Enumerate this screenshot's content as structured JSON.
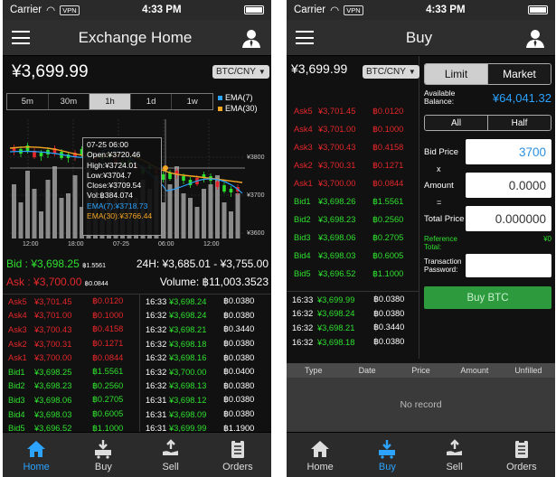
{
  "status": {
    "carrier": "Carrier",
    "vpn": "VPN",
    "time": "4:33 PM"
  },
  "home": {
    "title": "Exchange Home",
    "price": "¥3,699.99",
    "pair": "BTC/CNY",
    "timeframes": [
      "5m",
      "30m",
      "1h",
      "1d",
      "1w"
    ],
    "selected_timeframe": "1h",
    "legend": {
      "ema7": "EMA(7)",
      "ema30": "EMA(30)",
      "ema7_color": "#2ba3ff",
      "ema30_color": "#f5a623"
    },
    "chart": {
      "price_labels": [
        "¥3800",
        "¥3700",
        "¥3600"
      ],
      "time_labels": [
        "12:00",
        "18:00",
        "07-25",
        "06:00",
        "12:00"
      ]
    },
    "tooltip": {
      "date": "07-25 06:00",
      "open_label": "Open:",
      "open": "¥3720.46",
      "high_label": "High:",
      "high": "¥3724.01",
      "low_label": "Low:",
      "low": "¥3704.7",
      "close_label": "Close:",
      "close": "¥3709.54",
      "vol_label": "Vol:",
      "vol": "฿384.074",
      "ema7_label": "EMA(7):",
      "ema7": "¥3718.73",
      "ema30_label": "EMA(30):",
      "ema30": "¥3766.44"
    },
    "summary": {
      "bid_label": "Bid :",
      "bid_price": "¥3,698.25",
      "bid_amount": "฿1.5561",
      "range": "24H: ¥3,685.01 - ¥3,755.00",
      "ask_label": "Ask :",
      "ask_price": "¥3,700.00",
      "ask_amount": "฿0.0844",
      "volume": "Volume: ฿11,003.3523"
    },
    "asks": [
      {
        "label": "Ask5",
        "price": "¥3,701.45",
        "amount": "฿0.0120"
      },
      {
        "label": "Ask4",
        "price": "¥3,701.00",
        "amount": "฿0.1000"
      },
      {
        "label": "Ask3",
        "price": "¥3,700.43",
        "amount": "฿0.4158"
      },
      {
        "label": "Ask2",
        "price": "¥3,700.31",
        "amount": "฿0.1271"
      },
      {
        "label": "Ask1",
        "price": "¥3,700.00",
        "amount": "฿0.0844"
      }
    ],
    "bids": [
      {
        "label": "Bid1",
        "price": "¥3,698.25",
        "amount": "฿1.5561"
      },
      {
        "label": "Bid2",
        "price": "¥3,698.23",
        "amount": "฿0.2560"
      },
      {
        "label": "Bid3",
        "price": "¥3,698.06",
        "amount": "฿0.2705"
      },
      {
        "label": "Bid4",
        "price": "¥3,698.03",
        "amount": "฿0.6005"
      },
      {
        "label": "Bid5",
        "price": "¥3,696.52",
        "amount": "฿1.1000"
      }
    ],
    "trades": [
      {
        "time": "16:33",
        "price": "¥3,698.24",
        "amount": "฿0.0380",
        "side": "buy"
      },
      {
        "time": "16:32",
        "price": "¥3,698.24",
        "amount": "฿0.0380",
        "side": "buy"
      },
      {
        "time": "16:32",
        "price": "¥3,698.21",
        "amount": "฿0.3440",
        "side": "buy"
      },
      {
        "time": "16:32",
        "price": "¥3,698.18",
        "amount": "฿0.0380",
        "side": "buy"
      },
      {
        "time": "16:32",
        "price": "¥3,698.16",
        "amount": "฿0.0380",
        "side": "buy"
      },
      {
        "time": "16:32",
        "price": "¥3,700.00",
        "amount": "฿0.0400",
        "side": "buy"
      },
      {
        "time": "16:32",
        "price": "¥3,698.13",
        "amount": "฿0.0380",
        "side": "buy"
      },
      {
        "time": "16:31",
        "price": "¥3,698.12",
        "amount": "฿0.0380",
        "side": "buy"
      },
      {
        "time": "16:31",
        "price": "¥3,698.09",
        "amount": "฿0.0380",
        "side": "buy"
      },
      {
        "time": "16:31",
        "price": "¥3,699.99",
        "amount": "฿1.1900",
        "side": "buy"
      }
    ]
  },
  "buy": {
    "title": "Buy",
    "price": "¥3,699.99",
    "pair": "BTC/CNY",
    "asks": [
      {
        "label": "Ask5",
        "price": "¥3,701.45",
        "amount": "฿0.0120"
      },
      {
        "label": "Ask4",
        "price": "¥3,701.00",
        "amount": "฿0.1000"
      },
      {
        "label": "Ask3",
        "price": "¥3,700.43",
        "amount": "฿0.4158"
      },
      {
        "label": "Ask2",
        "price": "¥3,700.31",
        "amount": "฿0.1271"
      },
      {
        "label": "Ask1",
        "price": "¥3,700.00",
        "amount": "฿0.0844"
      }
    ],
    "bids": [
      {
        "label": "Bid1",
        "price": "¥3,698.26",
        "amount": "฿1.5561"
      },
      {
        "label": "Bid2",
        "price": "¥3,698.23",
        "amount": "฿0.2560"
      },
      {
        "label": "Bid3",
        "price": "¥3,698.06",
        "amount": "฿0.2705"
      },
      {
        "label": "Bid4",
        "price": "¥3,698.03",
        "amount": "฿0.6005"
      },
      {
        "label": "Bid5",
        "price": "¥3,696.52",
        "amount": "฿1.1000"
      }
    ],
    "trades": [
      {
        "time": "16:33",
        "price": "¥3,699.99",
        "amount": "฿0.0380"
      },
      {
        "time": "16:32",
        "price": "¥3,698.24",
        "amount": "฿0.0380"
      },
      {
        "time": "16:32",
        "price": "¥3,698.21",
        "amount": "฿0.3440"
      },
      {
        "time": "16:32",
        "price": "¥3,698.18",
        "amount": "฿0.0380"
      }
    ],
    "order_types": [
      "Limit",
      "Market"
    ],
    "available_label": "Available Balance:",
    "available_value": "¥64,041.32",
    "all_label": "All",
    "half_label": "Half",
    "bid_price_label": "Bid Price",
    "bid_price_value": "3700",
    "times": "x",
    "amount_label": "Amount",
    "amount_value": "0.0000",
    "equals": "=",
    "total_label": "Total Price",
    "total_value": "0.000000",
    "reference_label": "Reference Total:",
    "reference_value": "¥0",
    "password_label": "Transaction Password:",
    "buy_button": "Buy BTC",
    "order_columns": [
      "Type",
      "Date",
      "Price",
      "Amount",
      "Unfilled"
    ],
    "no_record": "No record"
  },
  "tabs": [
    "Home",
    "Buy",
    "Sell",
    "Orders"
  ],
  "colors": {
    "ask": "#e5262a",
    "bid": "#2ee02e",
    "accent": "#2ba3ff",
    "buy_button": "#2d9a3e"
  }
}
